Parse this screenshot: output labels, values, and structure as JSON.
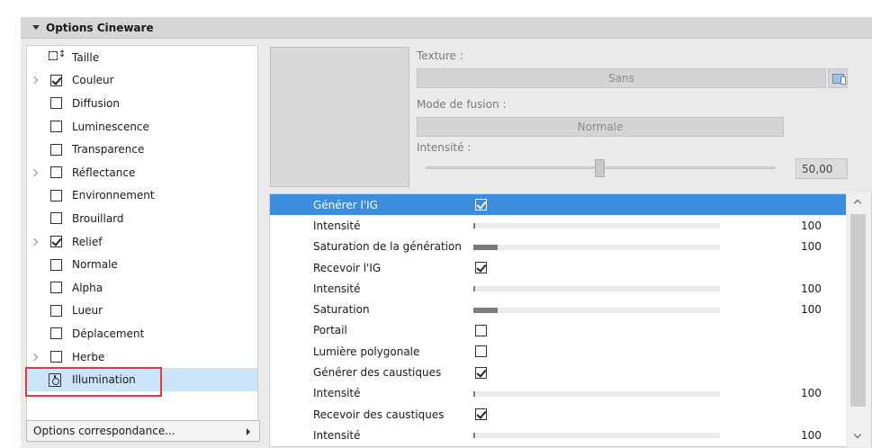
{
  "panel": {
    "title": "Options Cineware"
  },
  "tree": {
    "items": [
      {
        "label": "Taille",
        "expandable": false,
        "checkbox": false,
        "checked": false,
        "icon": "size-icon"
      },
      {
        "label": "Couleur",
        "expandable": true,
        "checkbox": true,
        "checked": true
      },
      {
        "label": "Diffusion",
        "expandable": false,
        "checkbox": true,
        "checked": false
      },
      {
        "label": "Luminescence",
        "expandable": false,
        "checkbox": true,
        "checked": false
      },
      {
        "label": "Transparence",
        "expandable": false,
        "checkbox": true,
        "checked": false
      },
      {
        "label": "Réflectance",
        "expandable": true,
        "checkbox": true,
        "checked": false
      },
      {
        "label": "Environnement",
        "expandable": false,
        "checkbox": true,
        "checked": false
      },
      {
        "label": "Brouillard",
        "expandable": false,
        "checkbox": true,
        "checked": false
      },
      {
        "label": "Relief",
        "expandable": true,
        "checkbox": true,
        "checked": true
      },
      {
        "label": "Normale",
        "expandable": false,
        "checkbox": true,
        "checked": false
      },
      {
        "label": "Alpha",
        "expandable": false,
        "checkbox": true,
        "checked": false
      },
      {
        "label": "Lueur",
        "expandable": false,
        "checkbox": true,
        "checked": false
      },
      {
        "label": "Déplacement",
        "expandable": false,
        "checkbox": true,
        "checked": false
      },
      {
        "label": "Herbe",
        "expandable": true,
        "checkbox": true,
        "checked": false
      },
      {
        "label": "Illumination",
        "expandable": false,
        "checkbox": false,
        "checked": false,
        "icon": "illumination-icon",
        "selected": true
      }
    ]
  },
  "options_button": {
    "label": "Options correspondance..."
  },
  "texture": {
    "label": "Texture :",
    "value": "Sans"
  },
  "blend_mode": {
    "label": "Mode de fusion :",
    "value": "Normale"
  },
  "intensity": {
    "label": "Intensité :",
    "value": "50,00"
  },
  "properties": [
    {
      "name": "Générer l'IG",
      "type": "checkbox",
      "checked": true,
      "selected": true
    },
    {
      "name": "Intensité",
      "type": "slider",
      "level": 0.0,
      "value": "100"
    },
    {
      "name": "Saturation de la génération",
      "type": "slider",
      "level": 0.1,
      "value": "100"
    },
    {
      "name": "Recevoir l'IG",
      "type": "checkbox",
      "checked": true
    },
    {
      "name": "Intensité",
      "type": "slider",
      "level": 0.0,
      "value": "100"
    },
    {
      "name": "Saturation",
      "type": "slider",
      "level": 0.1,
      "value": "100"
    },
    {
      "name": "Portail",
      "type": "checkbox",
      "checked": false
    },
    {
      "name": "Lumière polygonale",
      "type": "checkbox",
      "checked": false
    },
    {
      "name": "Générer des caustiques",
      "type": "checkbox",
      "checked": true
    },
    {
      "name": "Intensité",
      "type": "slider",
      "level": 0.0,
      "value": "100"
    },
    {
      "name": "Recevoir des caustiques",
      "type": "checkbox",
      "checked": true
    },
    {
      "name": "Intensité",
      "type": "slider",
      "level": 0.0,
      "value": "100"
    }
  ],
  "colors": {
    "selection": "#3b8de0",
    "tree_selection": "#cce4f7",
    "highlight_box": "#e53935"
  }
}
